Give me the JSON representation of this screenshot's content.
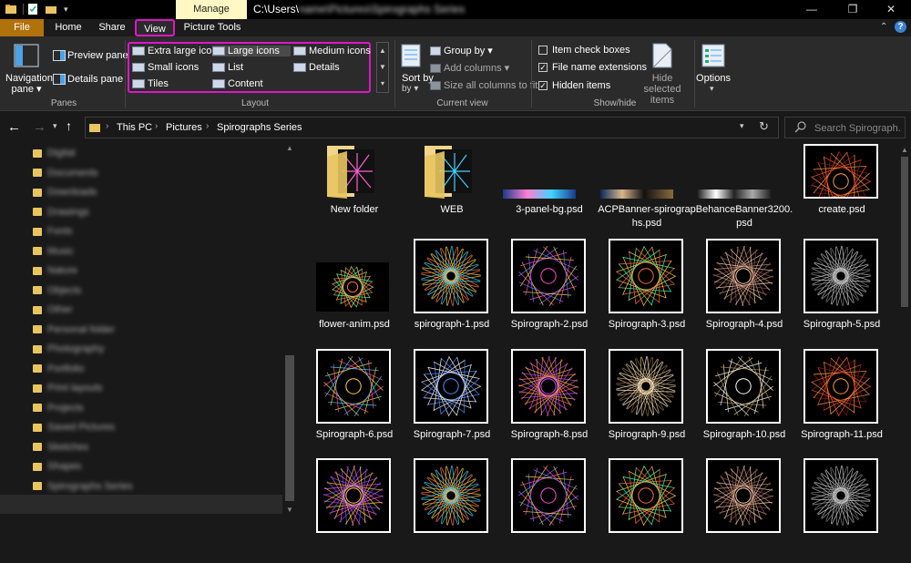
{
  "titlebar": {
    "manage_tab": "Manage",
    "path": "C:\\Users\\",
    "path_rest": "name\\Pictures\\Spirographs Series",
    "minimize": "—",
    "maximize": "❐",
    "close": "✕"
  },
  "tabs": {
    "file": "File",
    "home": "Home",
    "share": "Share",
    "view": "View",
    "picture_tools": "Picture Tools"
  },
  "ribbon": {
    "panes": {
      "navigation_pane": "Navigation pane ▾",
      "preview_pane": "Preview pane",
      "details_pane": "Details pane",
      "group_label": "Panes"
    },
    "layout": {
      "extra_large": "Extra large icons",
      "large": "Large icons",
      "medium": "Medium icons",
      "small": "Small icons",
      "list": "List",
      "details": "Details",
      "tiles": "Tiles",
      "content": "Content",
      "group_label": "Layout"
    },
    "current_view": {
      "sort_by": "Sort by",
      "group_by": "Group by ▾",
      "add_columns": "Add columns ▾",
      "size_all": "Size all columns to fit",
      "group_label": "Current view"
    },
    "show_hide": {
      "item_check_boxes": "Item check boxes",
      "file_name_extensions": "File name extensions",
      "hidden_items": "Hidden items",
      "hide_selected": "Hide selected items",
      "group_label": "Show/hide"
    },
    "options": "Options"
  },
  "address": {
    "crumbs": [
      "This PC",
      "Pictures",
      "Spirographs Series"
    ],
    "search_placeholder": "Search Spirograph..."
  },
  "nav": {
    "items": [
      "Digital",
      "Documents",
      "Downloads",
      "Drawings",
      "Fonts",
      "Music",
      "Nature",
      "Objects",
      "Other",
      "Personal folder",
      "Photography",
      "Portfolio",
      "Print layouts",
      "Projects",
      "Saved Pictures",
      "Sketches",
      "Shapes",
      "Spirographs Series"
    ]
  },
  "files": [
    {
      "label": "New folder",
      "type": "folder"
    },
    {
      "label": "WEB",
      "type": "folder"
    },
    {
      "label": "3-panel-bg.psd",
      "type": "strip"
    },
    {
      "label": "ACPBanner-spirographs.psd",
      "type": "strip"
    },
    {
      "label": "BehanceBanner3200.psd",
      "type": "strip"
    },
    {
      "label": "create.psd",
      "type": "spiro"
    },
    {
      "label": "flower-anim.psd",
      "type": "wide"
    },
    {
      "label": "spirograph-1.psd",
      "type": "spiro"
    },
    {
      "label": "Spirograph-2.psd",
      "type": "spiro"
    },
    {
      "label": "Spirograph-3.psd",
      "type": "spiro"
    },
    {
      "label": "Spirograph-4.psd",
      "type": "spiro"
    },
    {
      "label": "Spirograph-5.psd",
      "type": "spiro"
    },
    {
      "label": "Spirograph-6.psd",
      "type": "spiro"
    },
    {
      "label": "Spirograph-7.psd",
      "type": "spiro"
    },
    {
      "label": "Spirograph-8.psd",
      "type": "spiro"
    },
    {
      "label": "Spirograph-9.psd",
      "type": "spiro"
    },
    {
      "label": "Spirograph-10.psd",
      "type": "spiro"
    },
    {
      "label": "Spirograph-11.psd",
      "type": "spiro"
    },
    {
      "label": "",
      "type": "spiro"
    },
    {
      "label": "",
      "type": "spiro"
    },
    {
      "label": "",
      "type": "spiro"
    },
    {
      "label": "",
      "type": "spiro"
    },
    {
      "label": "",
      "type": "spiro"
    },
    {
      "label": "",
      "type": "spiro"
    }
  ],
  "colors": {
    "accent": "#e016c8",
    "file_tab": "#b0720a",
    "manage": "#fff8c4"
  }
}
